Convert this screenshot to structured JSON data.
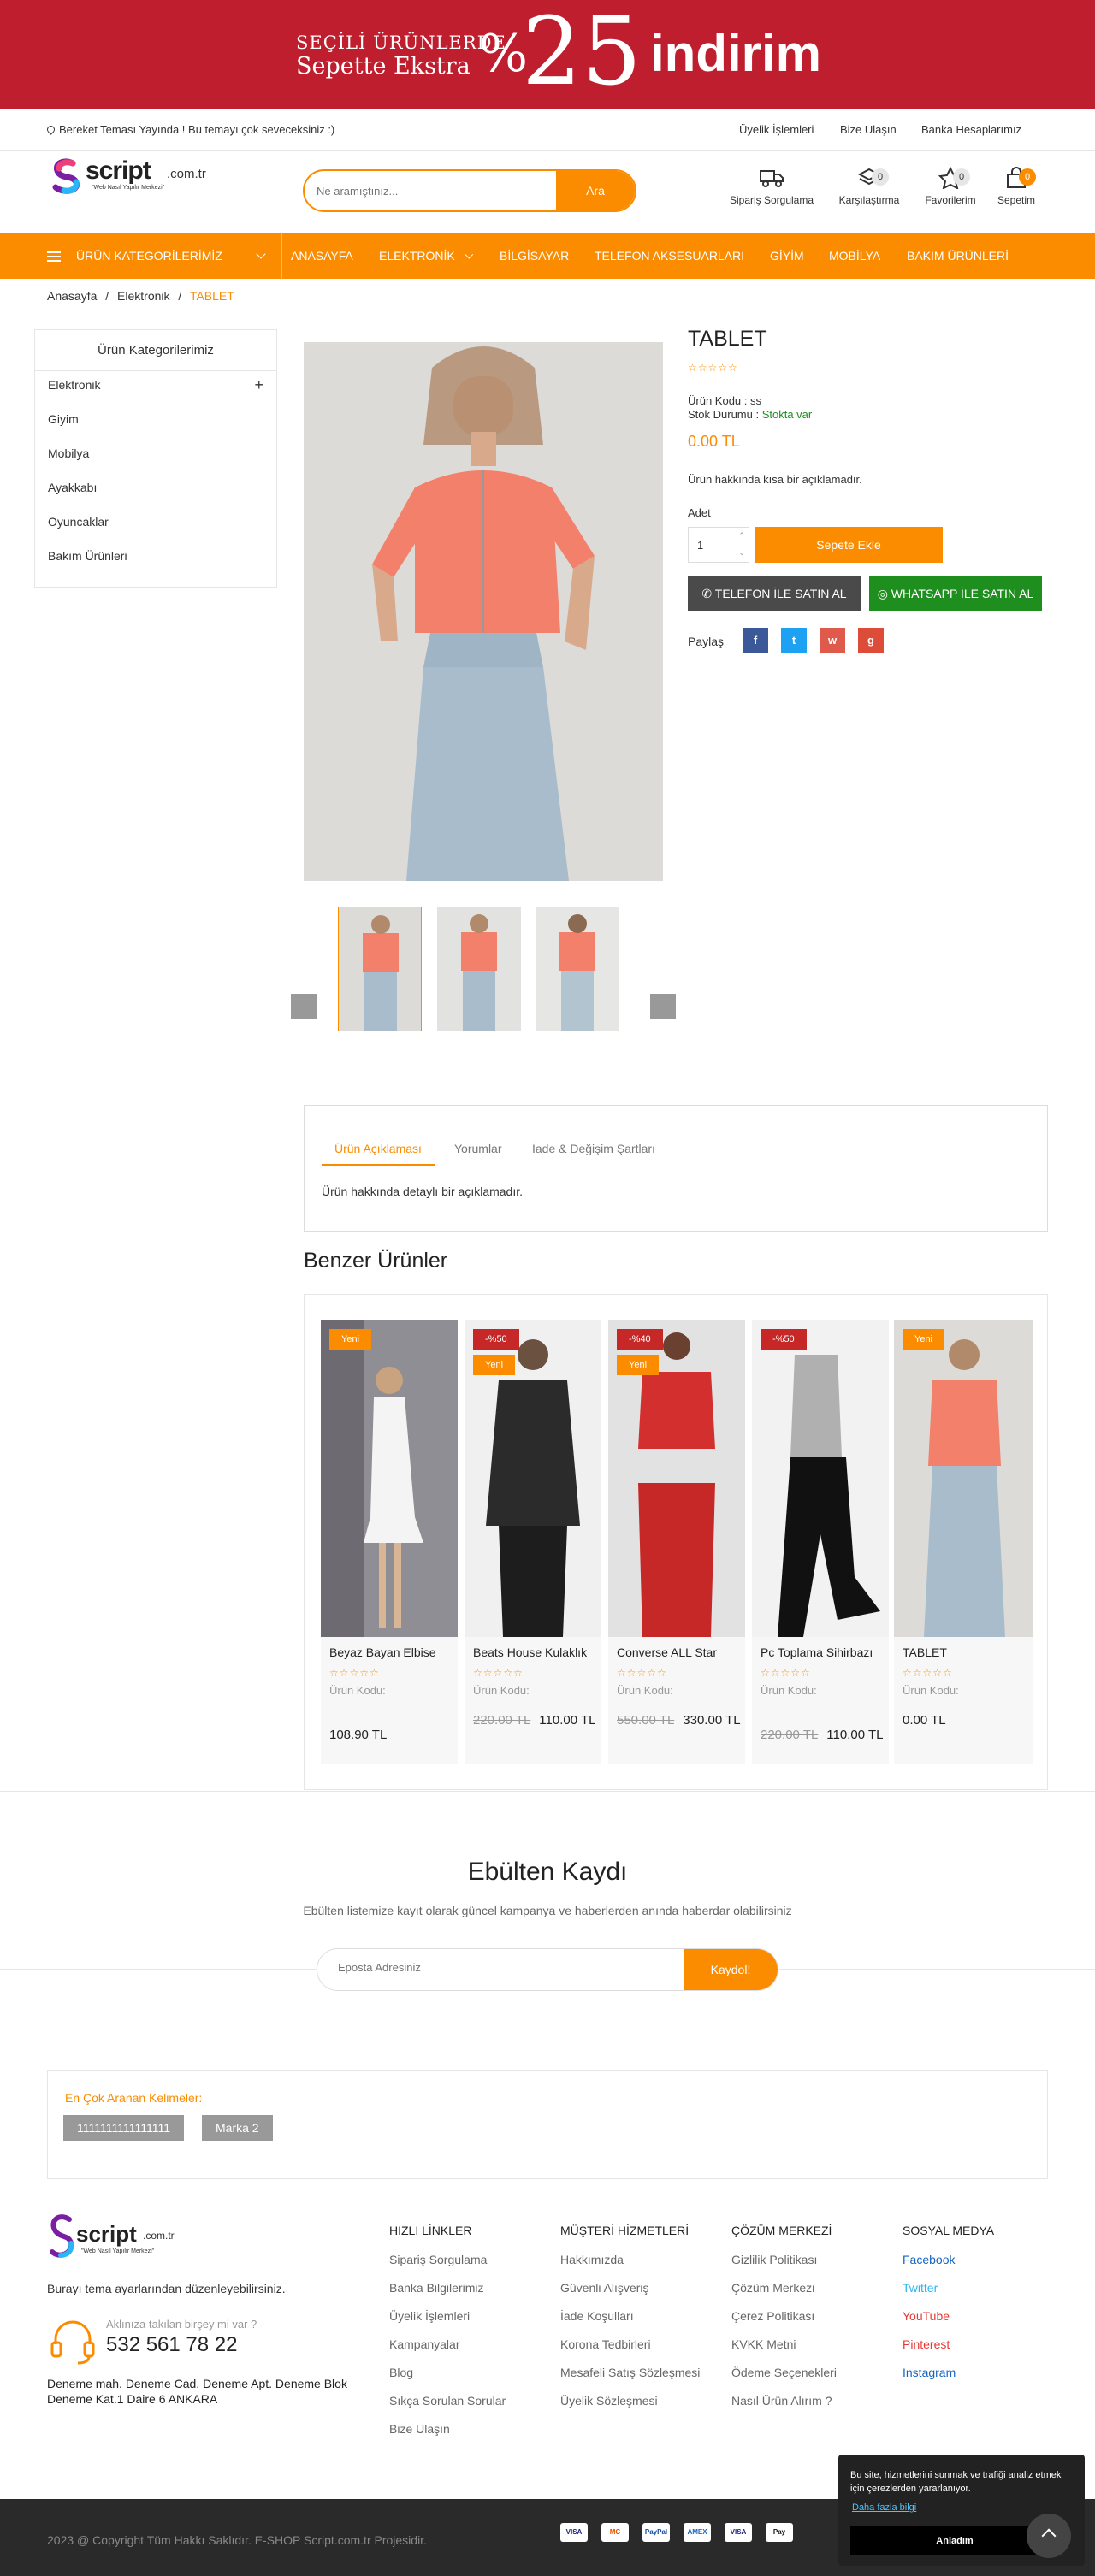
{
  "banner": {
    "line1": "SEÇİLİ ÜRÜNLERDE",
    "line2": "Sepette Ekstra",
    "percent": "%",
    "amount": "25",
    "word": "indirim"
  },
  "topbar": {
    "message": "Bereket Teması Yayında ! Bu temayı çok seveceksiniz :)",
    "links": [
      "Üyelik İşlemleri",
      "Bize Ulaşın",
      "Banka Hesaplarımız"
    ]
  },
  "logo": {
    "word": "script",
    "tld": ".com.tr",
    "tagline": "\"Web Nasıl Yapılır Merkezi\""
  },
  "search": {
    "placeholder": "Ne aramıştınız...",
    "button": "Ara"
  },
  "header_icons": [
    {
      "label": "Sipariş Sorgulama",
      "icon": "truck-icon"
    },
    {
      "label": "Karşılaştırma",
      "icon": "layers-icon",
      "count": "0"
    },
    {
      "label": "Favorilerim",
      "icon": "star-icon",
      "count": "0"
    },
    {
      "label": "Sepetim",
      "icon": "bag-icon",
      "count": "0"
    }
  ],
  "nav": {
    "categories": "ÜRÜN KATEGORİLERİMİZ",
    "items": [
      "ANASAYFA",
      "ELEKTRONİK",
      "BİLGİSAYAR",
      "TELEFON AKSESUARLARI",
      "GİYİM",
      "MOBİLYA",
      "BAKIM ÜRÜNLERİ"
    ]
  },
  "breadcrumb": [
    "Anasayfa",
    "Elektronik",
    "TABLET"
  ],
  "sidebar": {
    "title": "Ürün Kategorilerimiz",
    "items": [
      "Elektronik",
      "Giyim",
      "Mobilya",
      "Ayakkabı",
      "Oyuncaklar",
      "Bakım Ürünleri"
    ]
  },
  "product": {
    "title": "TABLET",
    "rating": 0,
    "code_label": "Ürün Kodu :",
    "code": "ss",
    "stock_label": "Stok Durumu :",
    "stock": "Stokta var",
    "price": "0.00 TL",
    "short_desc": "Ürün hakkında kısa bir açıklamadır.",
    "qty_label": "Adet",
    "qty": "1",
    "add_to_cart": "Sepete Ekle",
    "phone_buy": "TELEFON İLE SATIN AL",
    "whatsapp_buy": "WHATSAPP İLE SATIN AL",
    "share_label": "Paylaş"
  },
  "tabs": {
    "items": [
      "Ürün Açıklaması",
      "Yorumlar",
      "İade & Değişim Şartları"
    ],
    "content": "Ürün hakkında detaylı bir açıklamadır."
  },
  "similar": {
    "title": "Benzer Ürünler",
    "code_label": "Ürün Kodu:",
    "items": [
      {
        "name": "Beyaz Bayan Elbise",
        "tags": [
          "Yeni"
        ],
        "old": "",
        "price": "108.90 TL"
      },
      {
        "name": "Beats House Kulaklık",
        "tags": [
          "-%50",
          "Yeni"
        ],
        "old": "220.00 TL",
        "price": "110.00 TL"
      },
      {
        "name": "Converse ALL Star",
        "tags": [
          "-%40",
          "Yeni"
        ],
        "old": "550.00 TL",
        "price": "330.00 TL"
      },
      {
        "name": "Pc Toplama Sihirbazı",
        "tags": [
          "-%50"
        ],
        "old": "220.00 TL",
        "price": "110.00 TL"
      },
      {
        "name": "TABLET",
        "tags": [
          "Yeni"
        ],
        "old": "",
        "price": "0.00 TL"
      }
    ]
  },
  "newsletter": {
    "title": "Ebülten Kaydı",
    "subtitle": "Ebülten listemize kayıt olarak güncel kampanya ve haberlerden anında haberdar olabilirsiniz",
    "placeholder": "Eposta Adresiniz",
    "button": "Kaydol!"
  },
  "keywords": {
    "title": "En Çok Aranan Kelimeler:",
    "items": [
      "1111111111111111",
      "Marka 2"
    ]
  },
  "footer": {
    "about": "Burayı tema ayarlarından düzenleyebilirsiniz.",
    "phone_hint": "Aklınıza takılan birşey mi var ?",
    "phone": "532 561 78 22",
    "address": "Deneme mah. Deneme Cad. Deneme Apt. Deneme Blok Deneme Kat.1 Daire 6 ANKARA",
    "cols": [
      {
        "title": "HIZLI LİNKLER",
        "items": [
          "Sipariş Sorgulama",
          "Banka Bilgilerimiz",
          "Üyelik İşlemleri",
          "Kampanyalar",
          "Blog",
          "Sıkça Sorulan Sorular",
          "Bize Ulaşın"
        ]
      },
      {
        "title": "MÜŞTERİ HİZMETLERİ",
        "items": [
          "Hakkımızda",
          "Güvenli Alışveriş",
          "İade Koşulları",
          "Korona Tedbirleri",
          "Mesafeli Satış Sözleşmesi",
          "Üyelik Sözleşmesi"
        ]
      },
      {
        "title": "ÇÖZÜM MERKEZİ",
        "items": [
          "Gizlilik Politikası",
          "Çözüm Merkezi",
          "Çerez Politikası",
          "KVKK Metni",
          "Ödeme Seçenekleri",
          "Nasıl Ürün Alırım ?"
        ]
      },
      {
        "title": "SOSYAL MEDYA",
        "items": [
          "Facebook",
          "Twitter",
          "YouTube",
          "Pinterest",
          "Instagram"
        ]
      }
    ],
    "social_colors": [
      "#1565c0",
      "#29b6f6",
      "#e53935",
      "#e53935",
      "#1565c0"
    ],
    "copyright": "2023 @ Copyright Tüm Hakkı Saklıdır. E-SHOP Script.com.tr Projesidir.",
    "payments": [
      "VISA",
      "MC",
      "PayPal",
      "AMEX",
      "VISA",
      "Pay"
    ]
  },
  "cookie": {
    "text": "Bu site, hizmetlerini sunmak ve trafiği analiz etmek için çerezlerden yararlanıyor.",
    "more": "Daha fazla bilgi",
    "accept": "Anladım"
  },
  "colors": {
    "accent": "#fb8c00",
    "banner": "#be1e2d"
  }
}
